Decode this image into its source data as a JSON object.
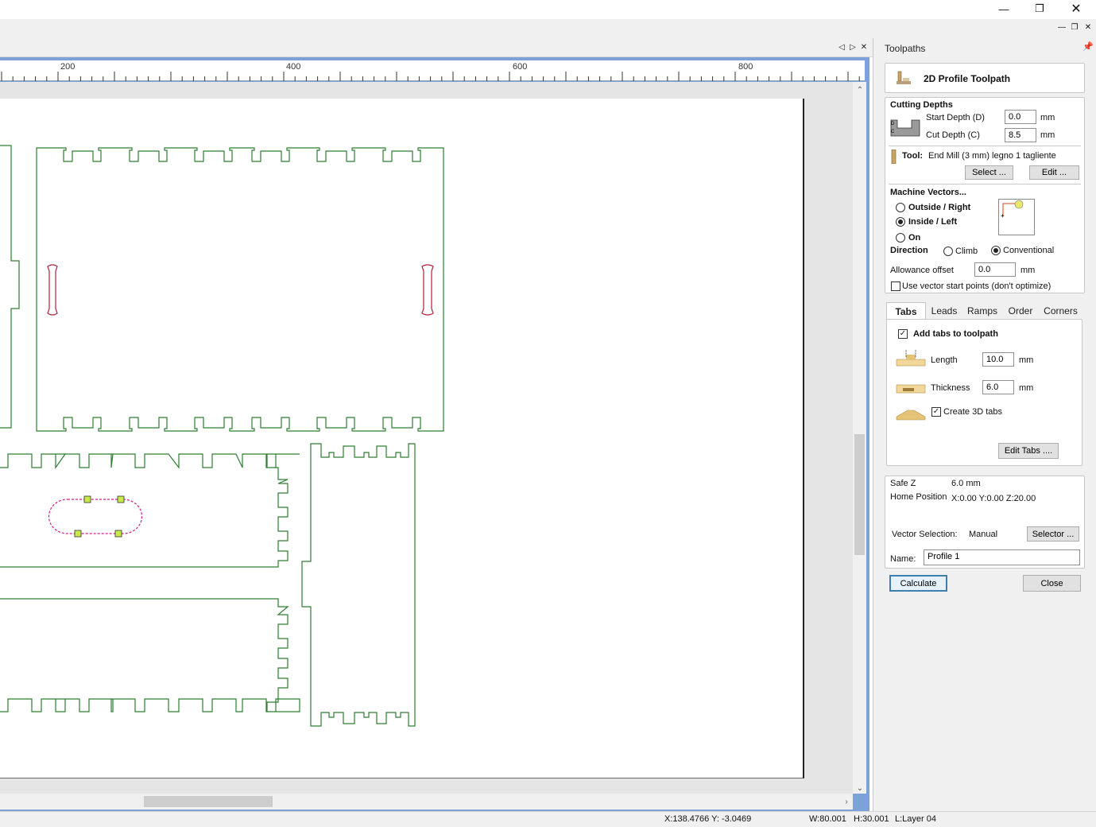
{
  "window": {
    "minimize_icon": "minimize-icon",
    "restore_icon": "restore-icon",
    "close_icon": "close-icon"
  },
  "ruler": {
    "ticks": [
      "200",
      "400",
      "600",
      "800"
    ]
  },
  "panel": {
    "title": "Toolpaths",
    "header": "2D Profile Toolpath",
    "cutting_depths": {
      "title": "Cutting Depths",
      "start_label": "Start Depth (D)",
      "start_value": "0.0",
      "cut_label": "Cut Depth (C)",
      "cut_value": "8.5",
      "unit": "mm"
    },
    "tool": {
      "label": "Tool:",
      "value": "End Mill (3 mm) legno 1 tagliente",
      "select_button": "Select ...",
      "edit_button": "Edit ..."
    },
    "machine_vectors": {
      "title": "Machine Vectors...",
      "options": [
        "Outside / Right",
        "Inside / Left",
        "On"
      ],
      "selected": "Inside / Left",
      "direction_label": "Direction",
      "direction_options": [
        "Climb",
        "Conventional"
      ],
      "direction_selected": "Conventional",
      "allowance_label": "Allowance offset",
      "allowance_value": "0.0",
      "allowance_unit": "mm",
      "vector_start_label": "Use vector start points (don't optimize)",
      "vector_start_checked": false
    },
    "tabs": [
      "Tabs",
      "Leads",
      "Ramps",
      "Order",
      "Corners"
    ],
    "active_tab": "Tabs",
    "tabs_page": {
      "add_tabs_label": "Add tabs to toolpath",
      "add_tabs_checked": true,
      "length_label": "Length",
      "length_value": "10.0",
      "thickness_label": "Thickness",
      "thickness_value": "6.0",
      "unit": "mm",
      "create_3d_label": "Create 3D tabs",
      "create_3d_checked": true,
      "edit_tabs_button": "Edit Tabs ...."
    },
    "info": {
      "safe_z_label": "Safe Z",
      "safe_z_value": "6.0 mm",
      "home_label": "Home Position",
      "home_value": "X:0.00 Y:0.00 Z:20.00",
      "vector_selection_label": "Vector Selection:",
      "vector_selection_value": "Manual",
      "selector_button": "Selector ...",
      "name_label": "Name:",
      "name_value": "Profile 1"
    },
    "calculate_button": "Calculate",
    "close_button": "Close"
  },
  "status": {
    "coords": "X:138.4766 Y: -3.0469",
    "width": "W:80.001",
    "height": "H:30.001",
    "layer": "L:Layer 04"
  },
  "colors": {
    "vector_green": "#2e7d32",
    "vector_red": "#b0203a",
    "selected_magenta": "#d81b8c",
    "tab_marker": "#c9e84a",
    "frame_blue": "#7da2d8"
  }
}
